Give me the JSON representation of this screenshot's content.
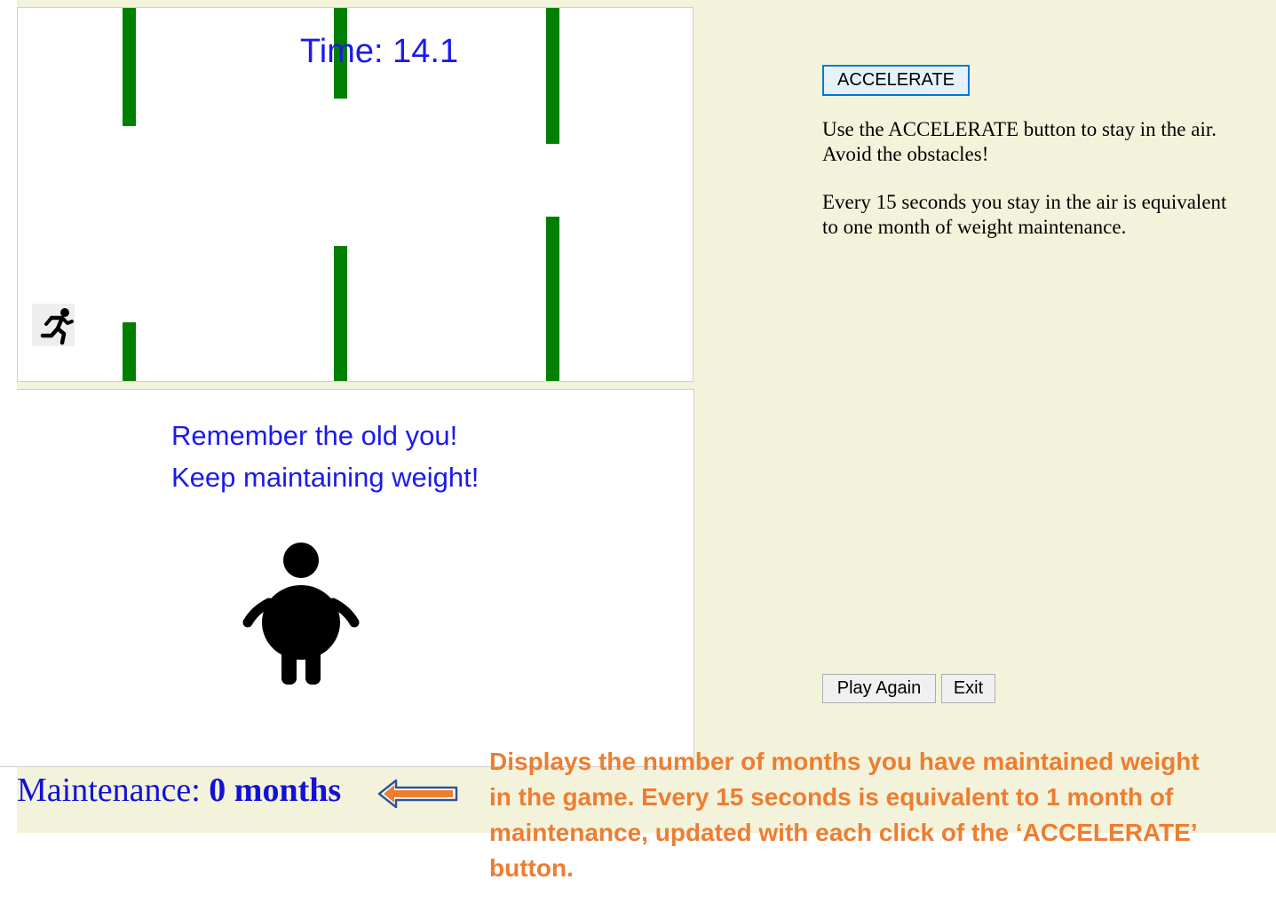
{
  "game": {
    "time_label": "Time: 14.1",
    "player_icon": "running-man-icon",
    "obstacle_color": "#008000"
  },
  "message": {
    "line1": "Remember the old you!",
    "line2": "Keep maintaining weight!",
    "figure_icon": "overweight-person-icon"
  },
  "controls": {
    "accelerate_label": "ACCELERATE",
    "play_again_label": "Play Again",
    "exit_label": "Exit"
  },
  "instructions": {
    "p1": "Use the ACCELERATE button to stay in the air. Avoid the obstacles!",
    "p2": "Every 15 seconds you stay in the air is equivalent to one month of weight maintenance."
  },
  "maintenance": {
    "label": "Maintenance: ",
    "value": "0 months"
  },
  "annotation": {
    "text": "Displays the number of months you have maintained weight in the game.  Every 15 seconds is equivalent to 1 month of maintenance, updated with each click of the ‘ACCELERATE’ button.",
    "arrow_color": "#ed7d31"
  }
}
